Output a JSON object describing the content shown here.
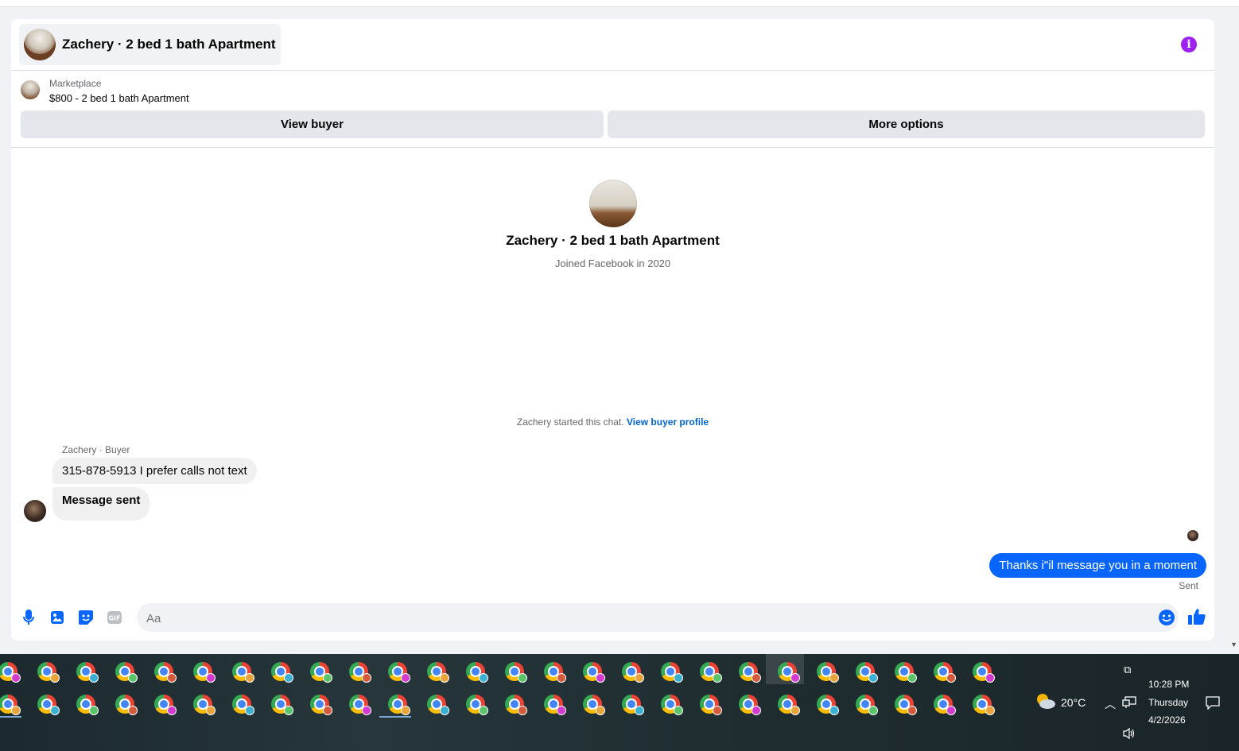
{
  "header": {
    "title": "Zachery · 2 bed 1 bath Apartment"
  },
  "listing": {
    "kicker": "Marketplace",
    "title": "$800 - 2 bed 1 bath Apartment",
    "view_buyer": "View buyer",
    "more_options": "More options"
  },
  "profile": {
    "name": "Zachery · 2 bed 1 bath Apartment",
    "joined": "Joined Facebook in 2020"
  },
  "chat": {
    "started_text": "Zachery started this chat.",
    "started_link": "View buyer profile",
    "sender_label": "Zachery · Buyer",
    "messages_in": [
      "315-878-5913 I prefer calls not text",
      "Message sent"
    ],
    "message_out": "Thanks i\"il message you in a moment",
    "sent_status": "Sent"
  },
  "composer": {
    "placeholder": "Aa",
    "icons": [
      "microphone-icon",
      "image-icon",
      "sticker-icon",
      "gif-icon",
      "emoji-icon",
      "thumbs-up-icon"
    ]
  },
  "taskbar": {
    "temperature": "20°C",
    "time": "10:28 PM",
    "day": "Thursday",
    "date": "4/2/2026"
  },
  "colors": {
    "accent": "#0866ff",
    "info": "#a020f0",
    "bubble_in": "#f0f0f0"
  }
}
